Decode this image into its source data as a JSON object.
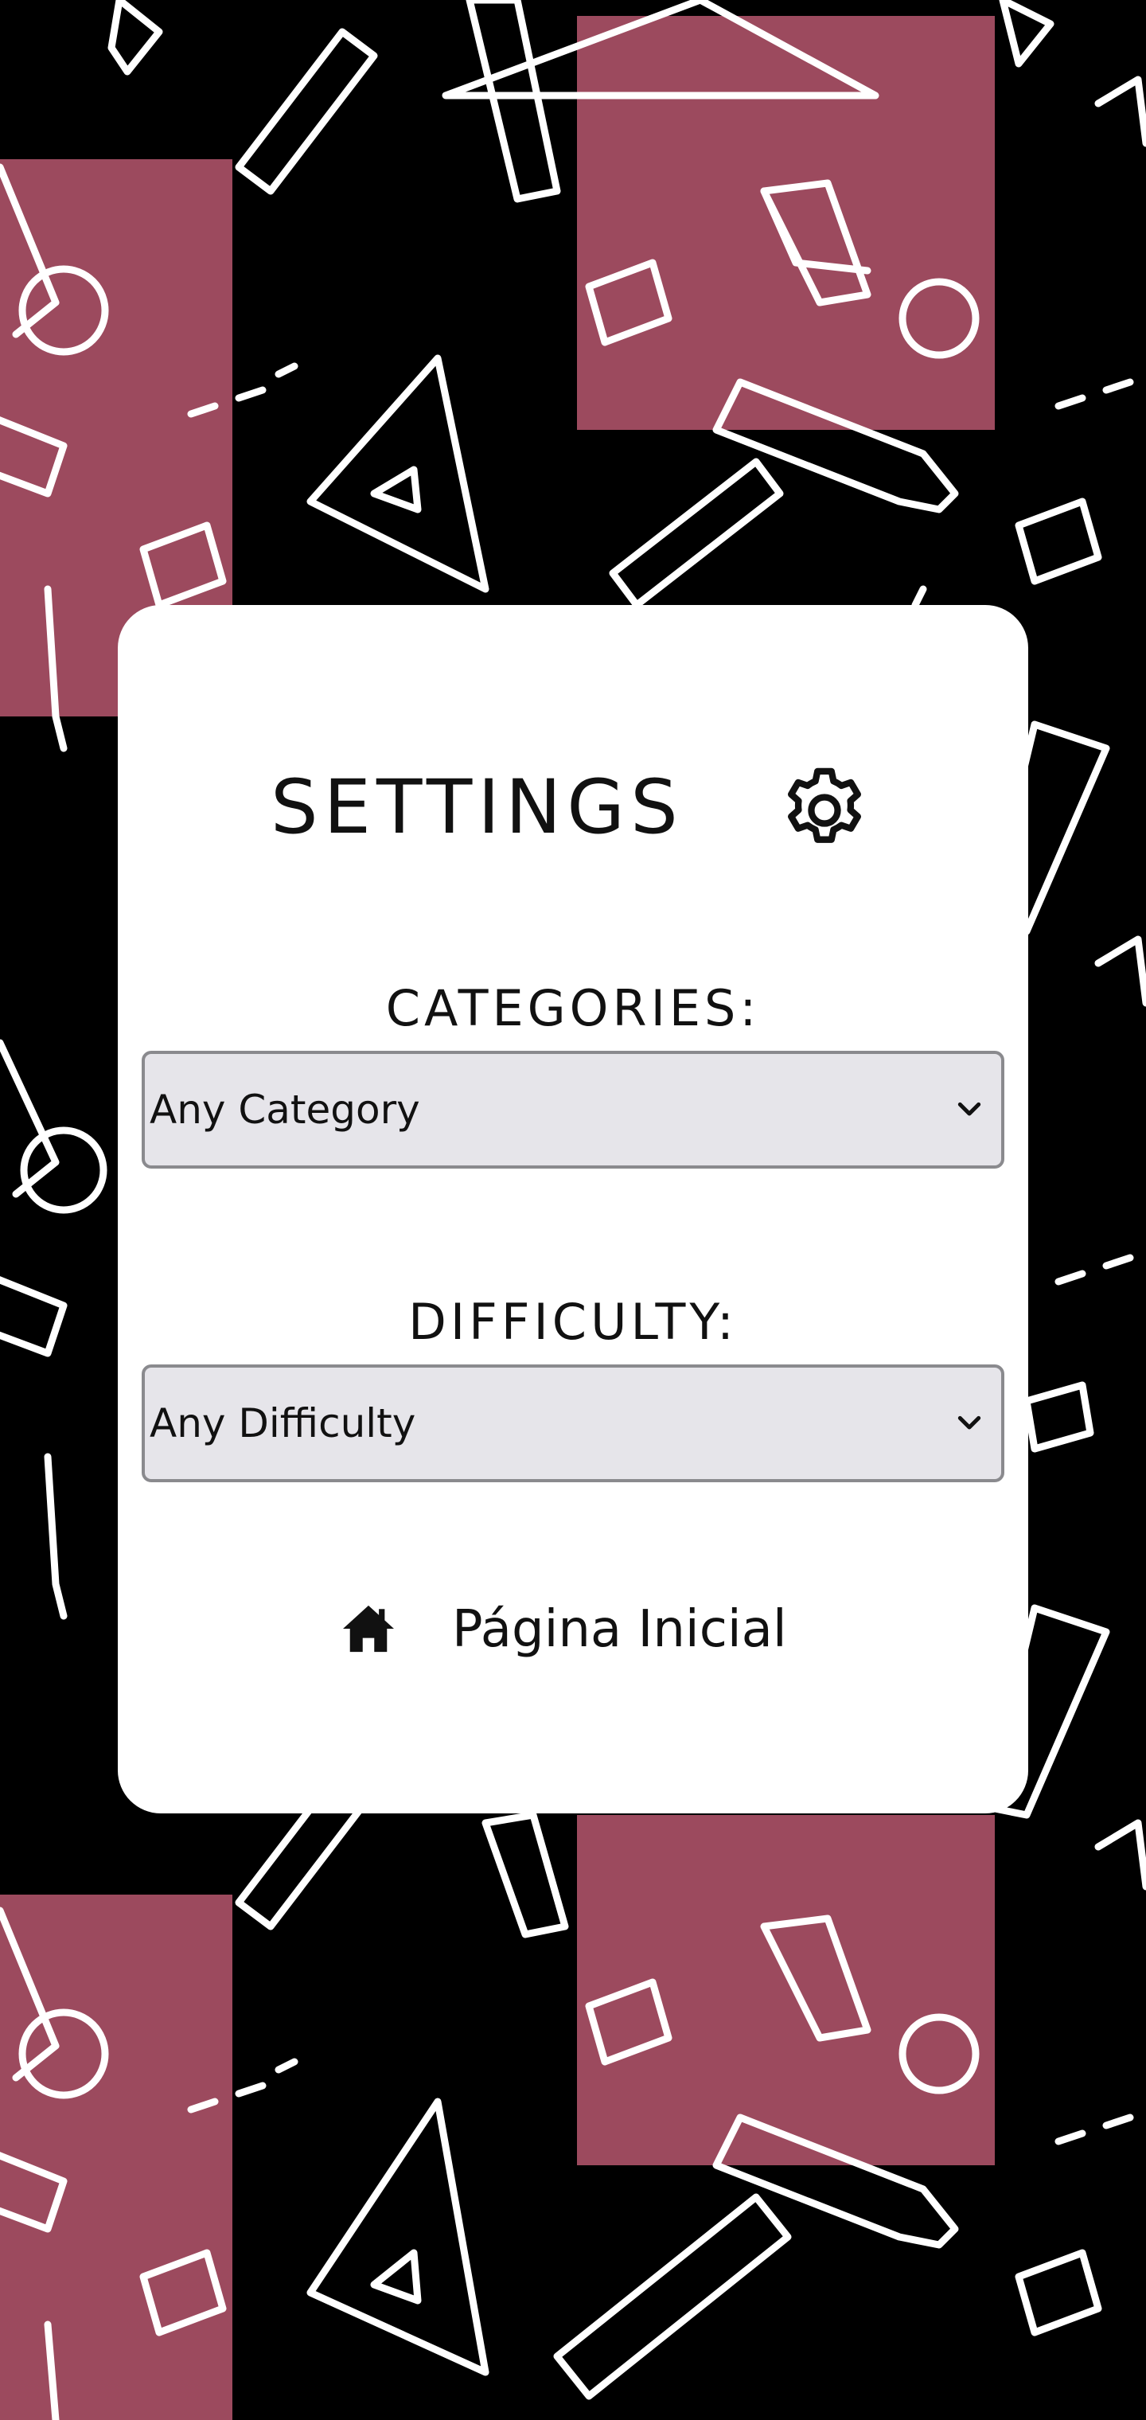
{
  "settings": {
    "title": "SETTINGS",
    "title_icon": "gear-icon"
  },
  "categories": {
    "label": "CATEGORIES:",
    "selected": "Any Category"
  },
  "difficulty": {
    "label": "DIFFICULTY:",
    "selected": "Any Difficulty"
  },
  "home": {
    "label": "Página Inicial",
    "icon": "home-icon"
  },
  "colors": {
    "background": "#000000",
    "pattern_tile": "#9c4a5e",
    "card": "#ffffff",
    "select_fill": "#e6e5ea",
    "select_border": "#8a8a8e",
    "text": "#111111"
  }
}
